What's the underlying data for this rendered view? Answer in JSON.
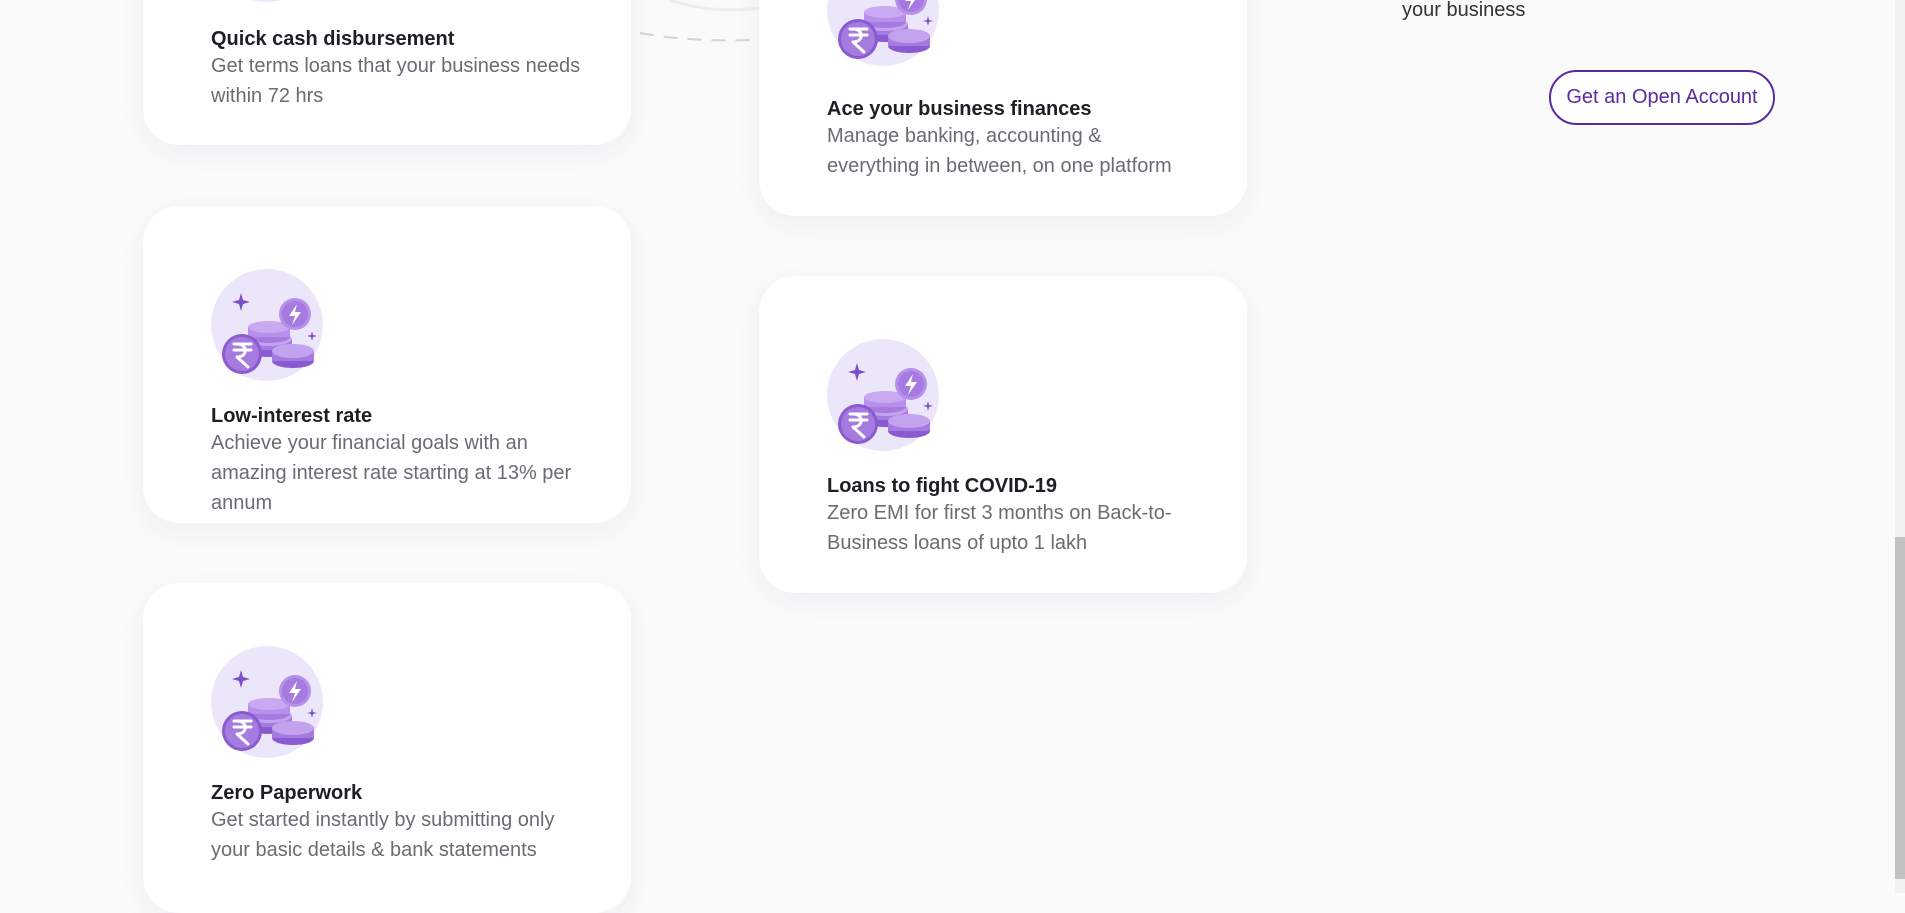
{
  "hero": {
    "tail_text": "your business",
    "cta_label": "Get an Open Account"
  },
  "features": [
    {
      "title": "Quick cash disbursement",
      "desc": "Get terms loans that your business needs within 72 hrs",
      "icon": "rupee-coins-lightning-icon"
    },
    {
      "title": "Ace your business finances",
      "desc": "Manage banking, accounting & everything in between, on one platform",
      "icon": "rupee-coins-lightning-icon"
    },
    {
      "title": "Low-interest rate",
      "desc": "Achieve your financial goals with an amazing interest rate starting at 13% per annum",
      "icon": "rupee-coins-lightning-icon"
    },
    {
      "title": "Loans to fight COVID-19",
      "desc": "Zero EMI for first 3 months on Back-to-Business loans of upto 1 lakh",
      "icon": "rupee-coins-lightning-icon"
    },
    {
      "title": "Zero Paperwork",
      "desc": "Get started instantly by submitting only your basic details & bank statements",
      "icon": "rupee-coins-lightning-icon"
    }
  ],
  "colors": {
    "accent": "#5a2aa0",
    "icon_bg": "#ece6fb",
    "coin": "#a57be0",
    "coin_dark": "#8a5bd0",
    "sparkle": "#7a4fc8"
  }
}
